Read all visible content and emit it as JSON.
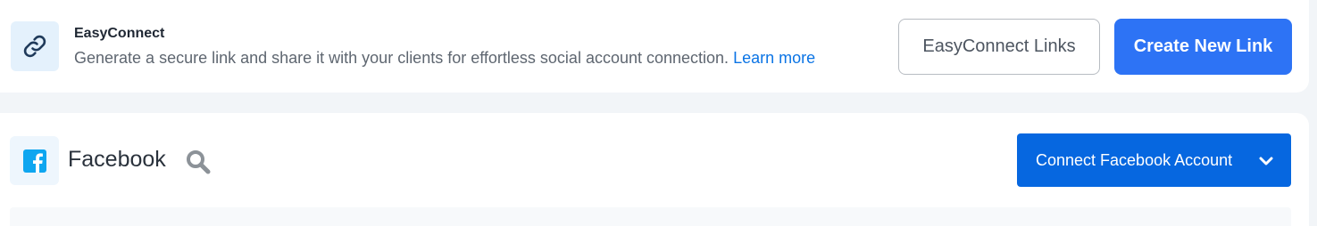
{
  "easyconnect": {
    "icon": "link-icon",
    "title": "EasyConnect",
    "description": "Generate a secure link and share it with your clients for effortless social account connection.",
    "learn_more": "Learn more",
    "links_button": "EasyConnect Links",
    "create_button": "Create New Link"
  },
  "facebook": {
    "icon": "facebook-icon",
    "title": "Facebook",
    "search_icon": "search-icon",
    "connect_button": "Connect Facebook Account",
    "connect_chevron": "chevron-down-icon"
  },
  "colors": {
    "primary": "#2d73f5",
    "connect": "#0667e0",
    "link": "#0b74e5",
    "facebook": "#0ea6f0"
  }
}
